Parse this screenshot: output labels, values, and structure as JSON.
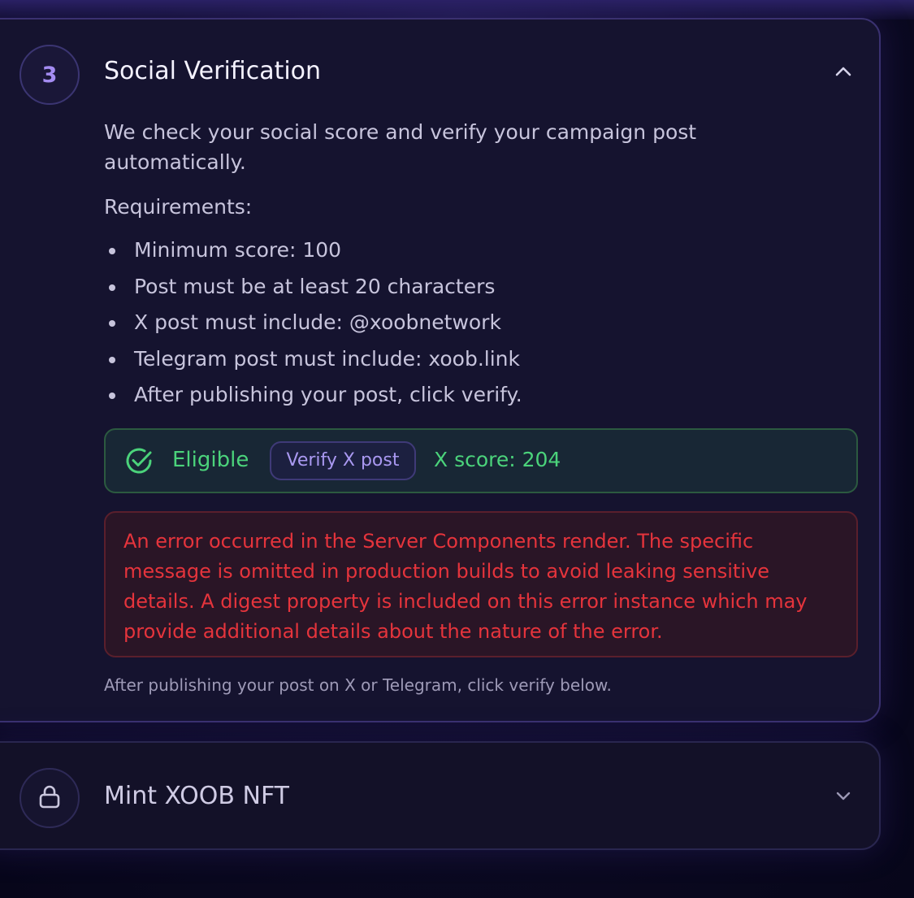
{
  "colors": {
    "accent_purple": "#a48cf2",
    "success_green": "#4bd37b",
    "error_red": "#e5343c",
    "card_bg": "#15132f"
  },
  "step3": {
    "number": "3",
    "title": "Social Verification",
    "expanded": true,
    "description": "We check your social score and verify your campaign post automatically.",
    "requirements_title": "Requirements:",
    "requirements": [
      "Minimum score: 100",
      "Post must be at least 20 characters",
      "X post must include: @xoobnetwork",
      "Telegram post must include: xoob.link",
      "After publishing your post, click verify."
    ],
    "status": {
      "icon": "check-circle-icon",
      "label": "Eligible",
      "verify_button": "Verify X post",
      "score_text": "X score: 204"
    },
    "error_message": "An error occurred in the Server Components render. The specific message is omitted in production builds to avoid leaking sensitive details. A digest property is included on this error instance which may provide additional details about the nature of the error.",
    "footnote": "After publishing your post on X or Telegram, click verify below."
  },
  "step4": {
    "icon": "lock-icon",
    "title": "Mint XOOB NFT",
    "expanded": false
  }
}
